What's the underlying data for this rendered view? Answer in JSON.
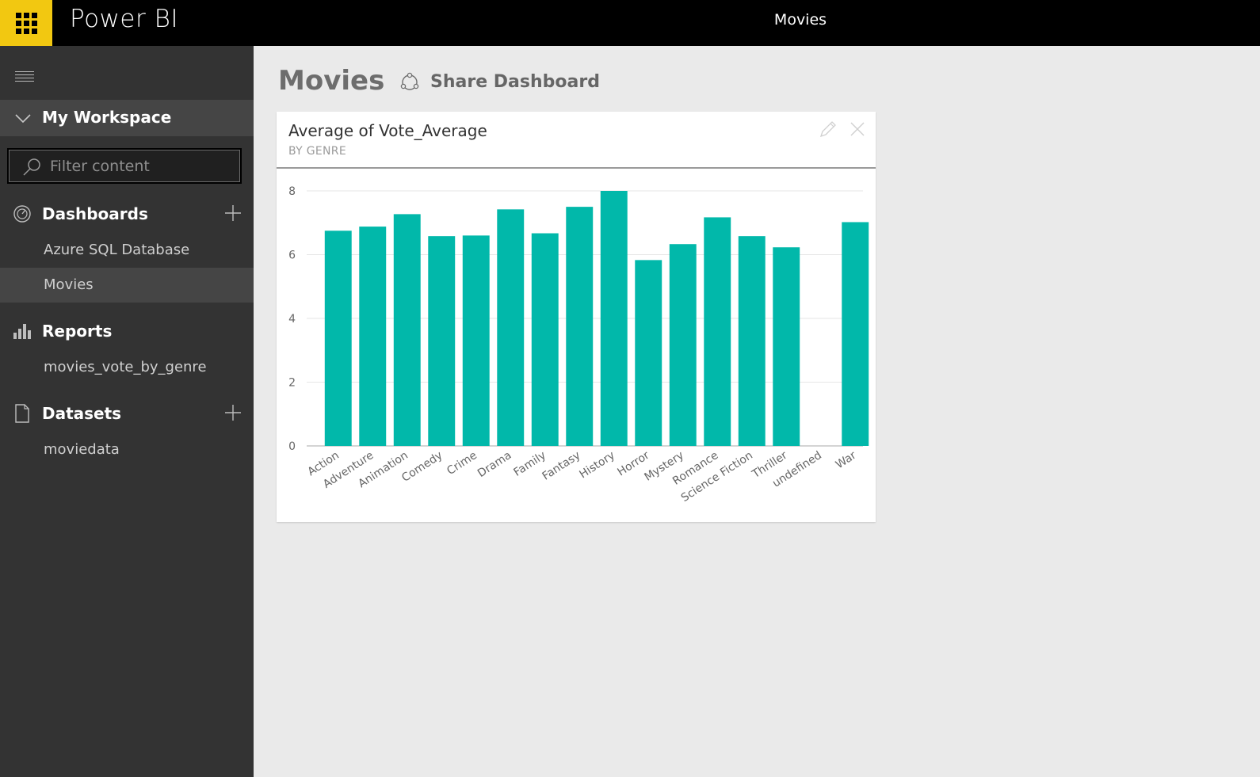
{
  "header": {
    "brand": "Power BI",
    "title": "Movies"
  },
  "sidebar": {
    "workspace_label": "My Workspace",
    "filter_placeholder": "Filter content",
    "sections": {
      "dashboards": {
        "label": "Dashboards",
        "items": [
          {
            "label": "Azure SQL Database",
            "active": false
          },
          {
            "label": "Movies",
            "active": true
          }
        ]
      },
      "reports": {
        "label": "Reports",
        "items": [
          {
            "label": "movies_vote_by_genre"
          }
        ]
      },
      "datasets": {
        "label": "Datasets",
        "items": [
          {
            "label": "moviedata"
          }
        ]
      }
    }
  },
  "main": {
    "page_title": "Movies",
    "share_label": "Share Dashboard"
  },
  "tile": {
    "title": "Average of Vote_Average",
    "subtitle": "BY GENRE"
  },
  "colors": {
    "accent_yellow": "#f2c811",
    "bar_color": "#01b8aa",
    "sidebar_bg": "#333333",
    "sidebar_active": "#454545"
  },
  "chart_data": {
    "type": "bar",
    "categories": [
      "Action",
      "Adventure",
      "Animation",
      "Comedy",
      "Crime",
      "Drama",
      "Family",
      "Fantasy",
      "History",
      "Horror",
      "Mystery",
      "Romance",
      "Science Fiction",
      "Thriller",
      "undefined",
      "War"
    ],
    "values": [
      6.75,
      6.88,
      7.27,
      6.58,
      6.6,
      7.42,
      6.67,
      7.5,
      8.0,
      5.83,
      6.33,
      7.17,
      6.58,
      6.23,
      0,
      7.02
    ],
    "title": "Average of Vote_Average",
    "subtitle": "BY GENRE",
    "xlabel": "",
    "ylabel": "",
    "ylim": [
      0,
      8
    ],
    "yticks": [
      0,
      2,
      4,
      6,
      8
    ],
    "grid": true
  }
}
